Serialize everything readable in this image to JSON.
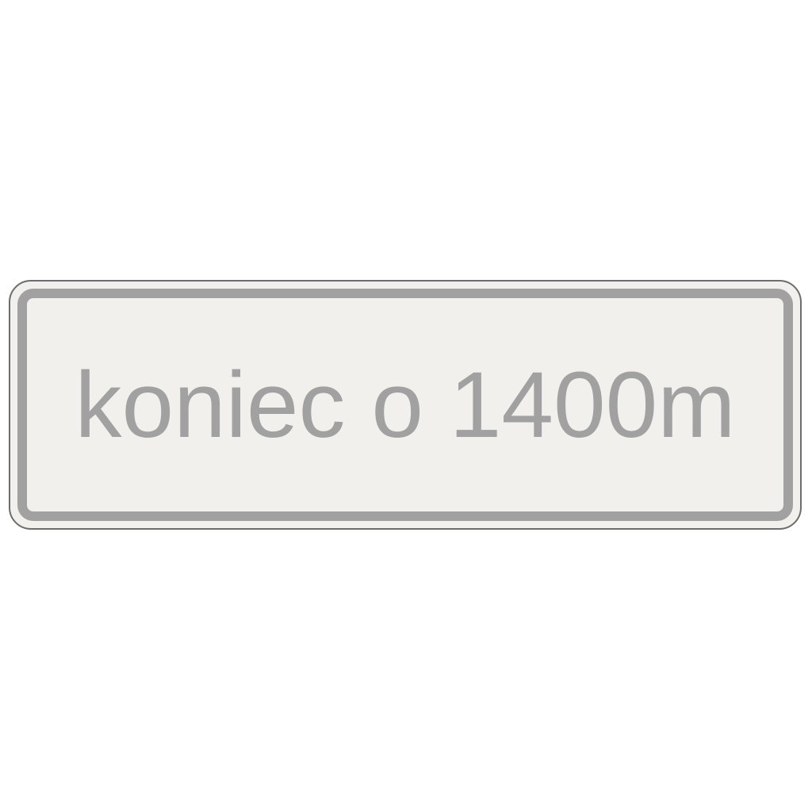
{
  "sign": {
    "text": "koniec o 1400m"
  },
  "colors": {
    "background": "#ffffff",
    "plate": "#f1f0ec",
    "outer_edge": "#6d6d6d",
    "frame": "#a1a1a1",
    "text": "#a1a1a1"
  }
}
